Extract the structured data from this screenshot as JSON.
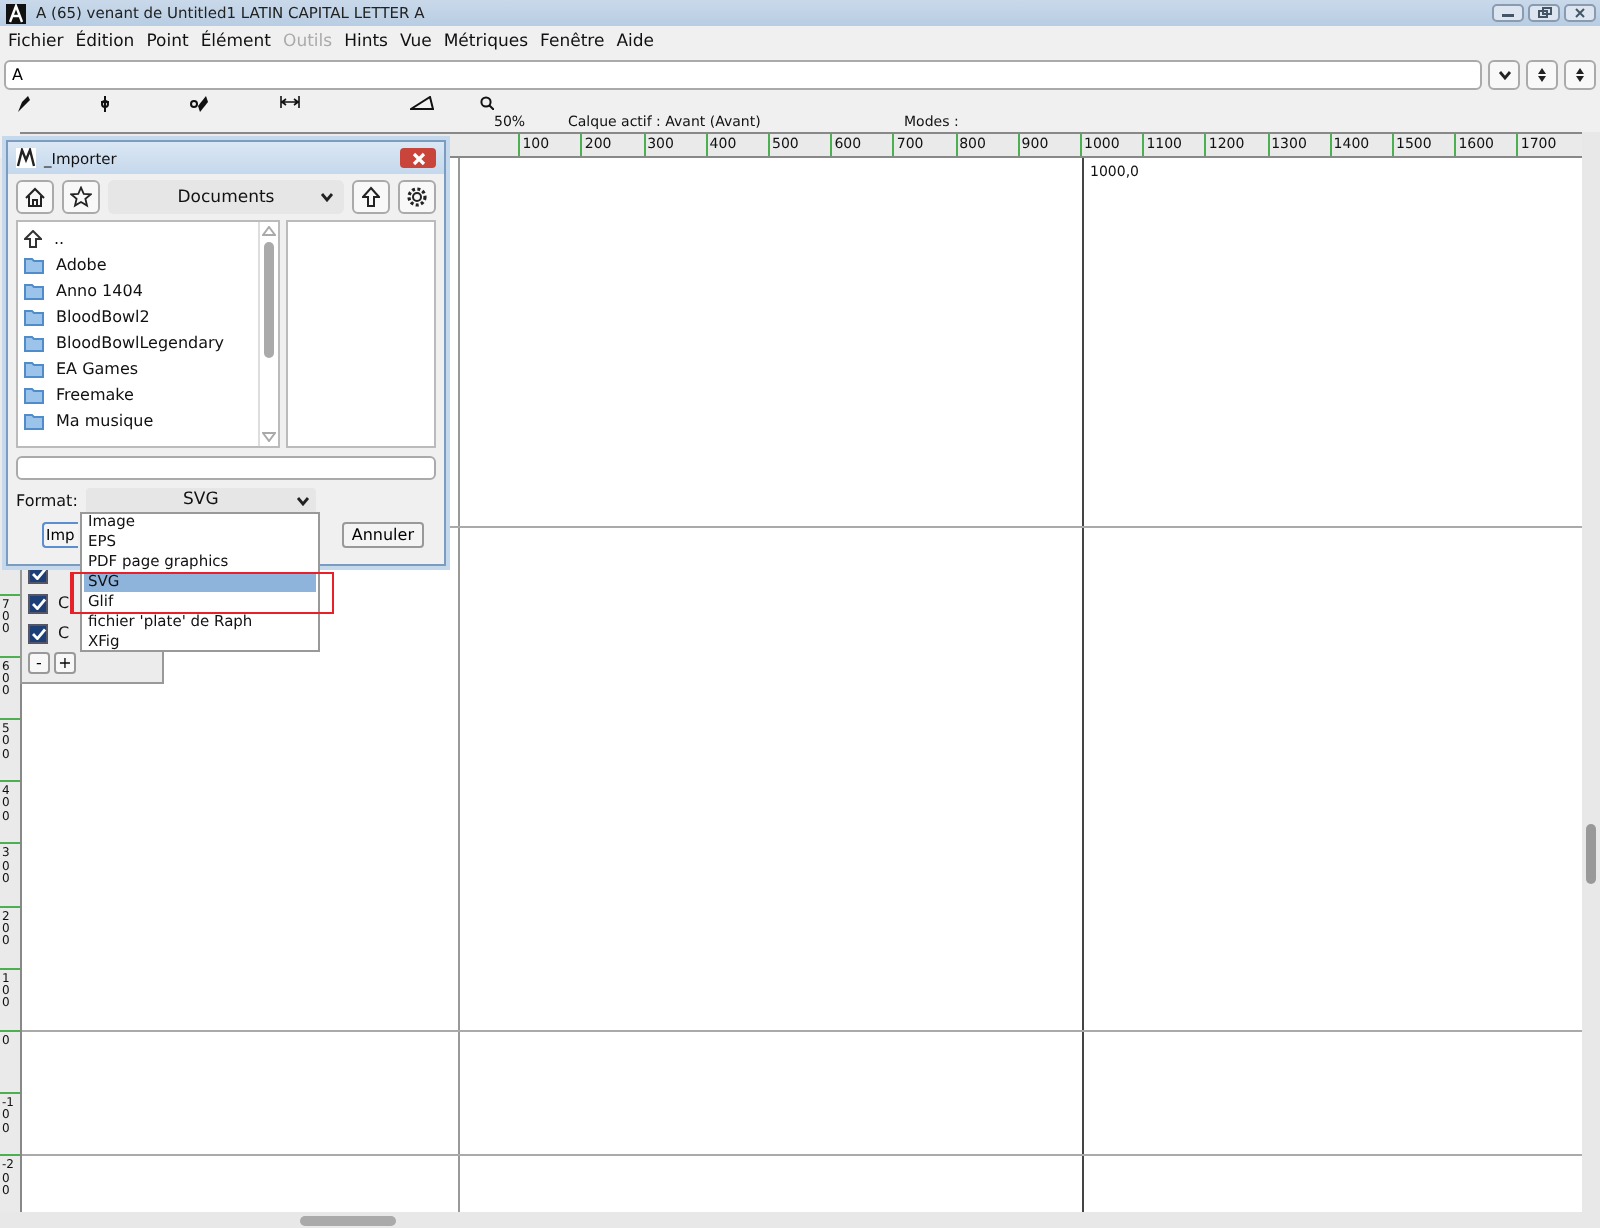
{
  "window": {
    "title": "A (65) venant de Untitled1 LATIN CAPITAL LETTER A"
  },
  "menu": [
    {
      "label": "Fichier",
      "disabled": false
    },
    {
      "label": "Édition",
      "disabled": false
    },
    {
      "label": "Point",
      "disabled": false
    },
    {
      "label": "Élément",
      "disabled": false
    },
    {
      "label": "Outils",
      "disabled": true
    },
    {
      "label": "Hints",
      "disabled": false
    },
    {
      "label": "Vue",
      "disabled": false
    },
    {
      "label": "Métriques",
      "disabled": false
    },
    {
      "label": "Fenêtre",
      "disabled": false
    },
    {
      "label": "Aide",
      "disabled": false
    }
  ],
  "glyph_field": {
    "value": "A"
  },
  "info": {
    "zoom": "50%",
    "layer": "Calque actif : Avant (Avant)",
    "modes": "Modes :"
  },
  "top_ruler": [
    "100",
    "200",
    "300",
    "400",
    "500",
    "600",
    "700",
    "800",
    "900",
    "1000",
    "1100",
    "1200",
    "1300",
    "1400",
    "1500",
    "1600",
    "1700"
  ],
  "left_ruler": [
    "700",
    "600",
    "500",
    "400",
    "300",
    "200",
    "100",
    "0",
    "-100",
    "-200"
  ],
  "canvas": {
    "coordinate": "1000,0"
  },
  "layers": {
    "rows": [
      {
        "checked": true,
        "label": ""
      },
      {
        "checked": true,
        "label": "C"
      },
      {
        "checked": true,
        "label": "C"
      }
    ],
    "buttons": [
      "-",
      "+"
    ]
  },
  "dialog": {
    "title": "_Importer",
    "folder": "Documents",
    "files": [
      {
        "kind": "parent",
        "name": ".."
      },
      {
        "kind": "folder",
        "name": "Adobe"
      },
      {
        "kind": "folder",
        "name": "Anno 1404"
      },
      {
        "kind": "folder",
        "name": "BloodBowl2"
      },
      {
        "kind": "folder",
        "name": "BloodBowlLegendary"
      },
      {
        "kind": "folder",
        "name": "EA Games"
      },
      {
        "kind": "folder",
        "name": "Freemake"
      },
      {
        "kind": "folder",
        "name": "Ma musique"
      }
    ],
    "format_label": "Format:",
    "format": "SVG",
    "buttons": [
      "Imp",
      "Annuler"
    ],
    "format_options": [
      {
        "label": "Image",
        "selected": false
      },
      {
        "label": "EPS",
        "selected": false
      },
      {
        "label": "PDF page graphics",
        "selected": false
      },
      {
        "label": "SVG",
        "selected": true
      },
      {
        "label": "Glif",
        "selected": false
      },
      {
        "label": "fichier 'plate' de Raph",
        "selected": false
      },
      {
        "label": "XFig",
        "selected": false
      }
    ]
  }
}
